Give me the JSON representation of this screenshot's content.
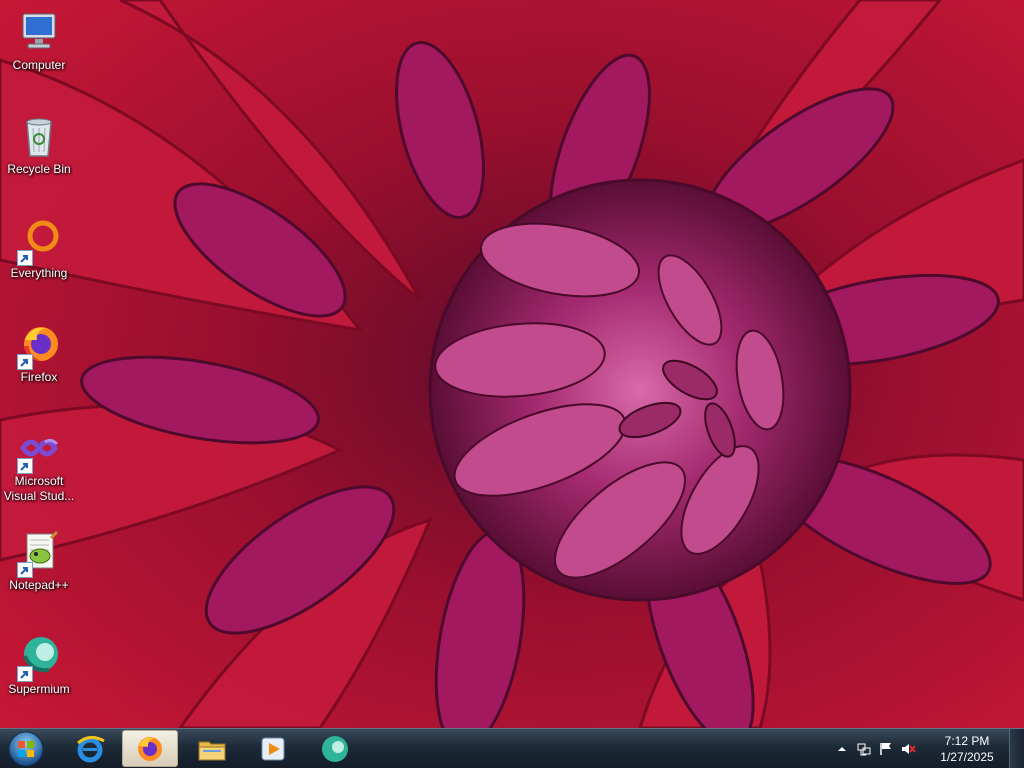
{
  "desktop": {
    "icons": [
      {
        "label": "Computer",
        "icon": "computer-icon"
      },
      {
        "label": "Recycle Bin",
        "icon": "recycle-bin-icon"
      },
      {
        "label": "Everything",
        "icon": "everything-icon"
      },
      {
        "label": "Firefox",
        "icon": "firefox-icon"
      },
      {
        "label": "Microsoft Visual Stud...",
        "icon": "visual-studio-icon"
      },
      {
        "label": "Notepad++",
        "icon": "notepadpp-icon"
      },
      {
        "label": "Supermium",
        "icon": "supermium-icon"
      }
    ]
  },
  "taskbar": {
    "pinned": [
      {
        "name": "internet-explorer",
        "icon": "ie-icon",
        "active": false
      },
      {
        "name": "firefox",
        "icon": "firefox-icon",
        "active": true
      },
      {
        "name": "file-explorer",
        "icon": "folder-icon",
        "active": false
      },
      {
        "name": "media-player",
        "icon": "media-player-icon",
        "active": false
      },
      {
        "name": "supermium",
        "icon": "supermium-icon",
        "active": false
      }
    ],
    "tray": {
      "icons": [
        "show-hidden-icons",
        "network-icon",
        "action-center-flag-icon",
        "volume-muted-icon"
      ],
      "time": "7:12 PM",
      "date": "1/27/2025"
    }
  },
  "colors": {
    "wallpaper_red": "#b3123a",
    "petal_magenta": "#9c1a5e",
    "taskbar_dark": "#1d2a38"
  }
}
